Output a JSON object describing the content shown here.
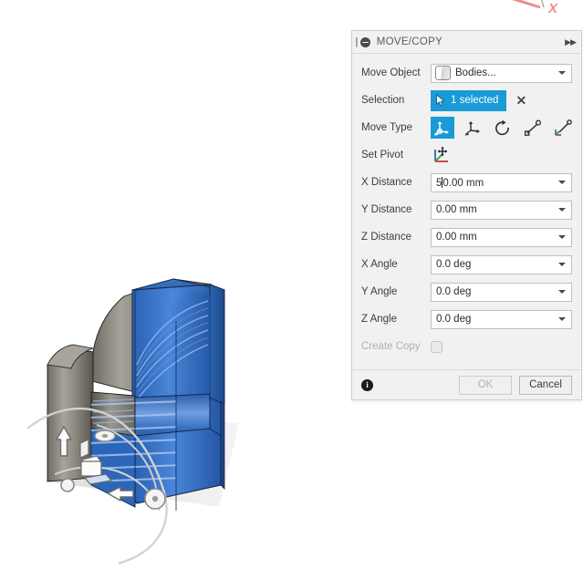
{
  "dialog": {
    "title": "MOVE/COPY",
    "grip_icon": "drag-grip-icon",
    "collapse_icon": "collapse-icon",
    "expand_icon": "expand-arrows-icon",
    "rows": {
      "move_object": {
        "label": "Move Object",
        "value": "Bodies...",
        "icon": "body-icon"
      },
      "selection": {
        "label": "Selection",
        "button_text": "1 selected",
        "cursor_icon": "cursor-arrow-icon",
        "clear_label": "✕"
      },
      "move_type": {
        "label": "Move Type",
        "options": [
          "free-move-icon",
          "translate-icon",
          "rotate-icon",
          "point-to-point-icon",
          "point-to-position-icon"
        ],
        "selected_index": 0
      },
      "set_pivot": {
        "label": "Set Pivot",
        "icon": "set-pivot-axis-icon"
      },
      "x_distance": {
        "label": "X Distance",
        "value_before_caret": "5",
        "value_after_caret": "0.00 mm",
        "value": "50.00 mm"
      },
      "y_distance": {
        "label": "Y Distance",
        "value": "0.00 mm"
      },
      "z_distance": {
        "label": "Z Distance",
        "value": "0.00 mm"
      },
      "x_angle": {
        "label": "X Angle",
        "value": "0.0 deg"
      },
      "y_angle": {
        "label": "Y Angle",
        "value": "0.0 deg"
      },
      "z_angle": {
        "label": "Z Angle",
        "value": "0.0 deg"
      },
      "create_copy": {
        "label": "Create Copy",
        "checked": false,
        "enabled": false
      }
    },
    "footer": {
      "info_glyph": "i",
      "ok_label": "OK",
      "ok_enabled": false,
      "cancel_label": "Cancel"
    }
  },
  "viewport": {
    "axis_label_x": "X",
    "manipulator": {
      "arrow_up_icon": "translate-arrow-up-icon",
      "arrow_right_icon": "translate-arrow-right-icon",
      "rotate_handle_icon": "rotate-handle-icon",
      "origin_handle_icon": "origin-handle-icon"
    }
  },
  "colors": {
    "accent_blue": "#1a9ad7",
    "model_blue": "#2f6fc4",
    "model_gray": "#6d6a63",
    "axis_red": "#f08a8a",
    "panel_bg": "#f1f1f1",
    "canvas_bg": "#ffffff"
  }
}
